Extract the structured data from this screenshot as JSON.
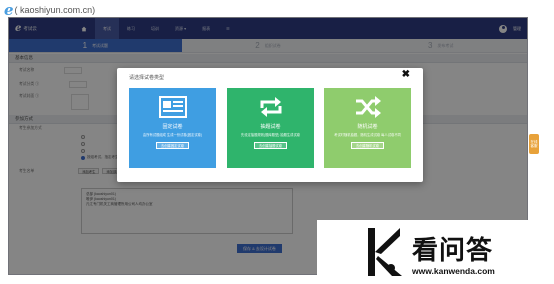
{
  "watermark": {
    "text": "( kaoshiyun.com.cn)"
  },
  "nav": {
    "logo_text": "考试云",
    "home_icon": "home-icon",
    "items": [
      {
        "label": "考试",
        "active": true
      },
      {
        "label": "练习",
        "active": false
      },
      {
        "label": "培训",
        "active": false
      },
      {
        "label": "资源 ▾",
        "active": false
      },
      {
        "label": "报表",
        "active": false
      },
      {
        "label": "☰",
        "active": false
      }
    ],
    "user_name": "管理"
  },
  "steps": [
    {
      "num": "1",
      "label": "考试试题",
      "active": true
    },
    {
      "num": "2",
      "label": "组织试卷",
      "active": false
    },
    {
      "num": "3",
      "label": "发布考试",
      "active": false
    }
  ],
  "basic": {
    "header": "基本信息",
    "rows": [
      "考试名称",
      "考试分类 ①",
      "考试封面 ①"
    ]
  },
  "params": {
    "header": "参加方式",
    "row_label": "考生参加方式",
    "options": [
      "",
      "",
      "",
      "按组考试，指定考生范围与限定，非考生范围内考生参加考试可以进入考试 ①"
    ],
    "option_link": "选择考生 ● 添加考生",
    "examiner_label": "考生名单",
    "buttons": [
      "添加考生",
      "添加部门",
      "批量导入",
      "删除"
    ],
    "buttons_note": "考试时间考生会从后台 ● 考生中心查看测试",
    "examiners": [
      "总部 (kaoshiyun01)",
      "唯伊 (kaoshiyun01)",
      "凡江专门机关工商管理所用公司人均办公室"
    ]
  },
  "save_button": "保存 & 去设计试卷",
  "side_tab": "在线客服",
  "modal": {
    "title": "请选择试卷类型",
    "close": "✖",
    "cards": [
      {
        "title": "固定试卷",
        "desc": "由所有试题组成 生成一份试卷(固定试卷)",
        "button": "去创建固定试卷",
        "color": "#3f9ee2",
        "icon": "newspaper-icon"
      },
      {
        "title": "抽题试卷",
        "desc": "先设定抽题规则(题库题型) 抽题生成试卷",
        "button": "去创建抽题试卷",
        "color": "#2fb46c",
        "icon": "refresh-arrows-icon"
      },
      {
        "title": "随机试卷",
        "desc": "考试时随机抽题，随机生成试卷 每人试卷不同",
        "button": "去创建随机试卷",
        "color": "#8fcc6d",
        "icon": "shuffle-icon"
      }
    ]
  },
  "brand": {
    "name": "看问答",
    "url": "www.kanwenda.com"
  }
}
